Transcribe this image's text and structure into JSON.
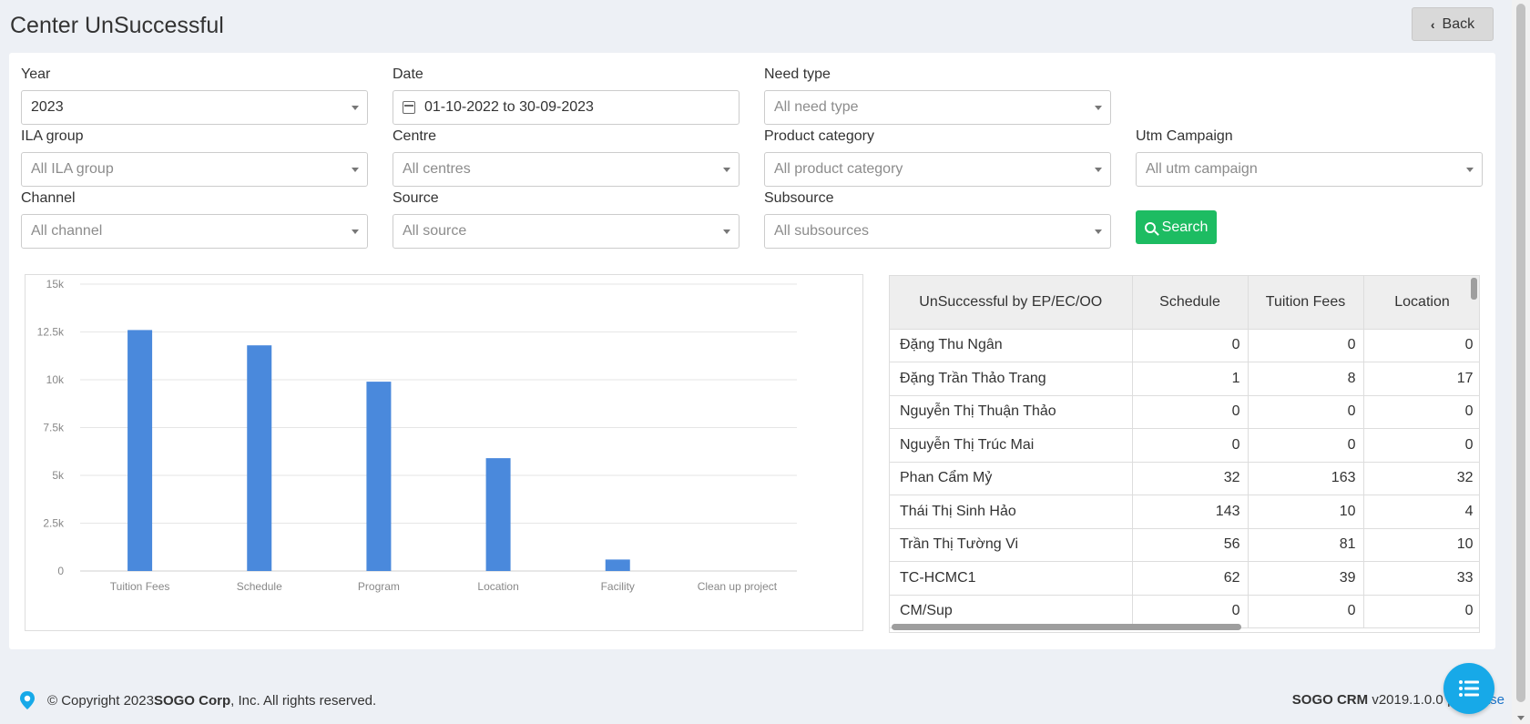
{
  "page": {
    "title": "Center UnSuccessful",
    "back_label": "Back"
  },
  "filters": {
    "year": {
      "label": "Year",
      "value": "2023"
    },
    "date": {
      "label": "Date",
      "value": "01-10-2022 to 30-09-2023"
    },
    "need_type": {
      "label": "Need type",
      "placeholder": "All need type"
    },
    "ila_group": {
      "label": "ILA group",
      "placeholder": "All ILA group"
    },
    "centre": {
      "label": "Centre",
      "placeholder": "All centres"
    },
    "product_category": {
      "label": "Product category",
      "placeholder": "All product category"
    },
    "utm_campaign": {
      "label": "Utm Campaign",
      "placeholder": "All utm campaign"
    },
    "channel": {
      "label": "Channel",
      "placeholder": "All channel"
    },
    "source": {
      "label": "Source",
      "placeholder": "All source"
    },
    "subsource": {
      "label": "Subsource",
      "placeholder": "All subsources"
    },
    "search_label": "Search"
  },
  "chart_data": {
    "type": "bar",
    "categories": [
      "Tuition Fees",
      "Schedule",
      "Program",
      "Location",
      "Facility",
      "Clean up project"
    ],
    "values": [
      12600,
      11800,
      9900,
      5900,
      600,
      0
    ],
    "ylim": [
      0,
      15000
    ],
    "yticks": [
      "0",
      "2.5k",
      "5k",
      "7.5k",
      "10k",
      "12.5k",
      "15k"
    ],
    "grid": true,
    "color": "#4a89dc"
  },
  "table": {
    "headers": [
      "UnSuccessful by EP/EC/OO",
      "Schedule",
      "Tuition Fees",
      "Location"
    ],
    "rows": [
      [
        "Đặng Thu Ngân",
        "0",
        "0",
        "0"
      ],
      [
        "Đặng Trần Thảo Trang",
        "1",
        "8",
        "17"
      ],
      [
        "Nguyễn Thị Thuận Thảo",
        "0",
        "0",
        "0"
      ],
      [
        "Nguyễn Thị Trúc Mai",
        "0",
        "0",
        "0"
      ],
      [
        "Phan Cẩm Mỷ",
        "32",
        "163",
        "32"
      ],
      [
        "Thái Thị Sinh Hảo",
        "143",
        "10",
        "4"
      ],
      [
        "Trần Thị Tường Vi",
        "56",
        "81",
        "10"
      ],
      [
        "TC-HCMC1",
        "62",
        "39",
        "33"
      ],
      [
        "CM/Sup",
        "0",
        "0",
        "0"
      ]
    ]
  },
  "footer": {
    "copyright_prefix": "© Copyright 2023 ",
    "company": "SOGO Corp",
    "copyright_suffix": ", Inc. All rights reserved.",
    "product": "SOGO CRM",
    "version": " v2019.1.0.0 | ",
    "release_link": "Release"
  }
}
